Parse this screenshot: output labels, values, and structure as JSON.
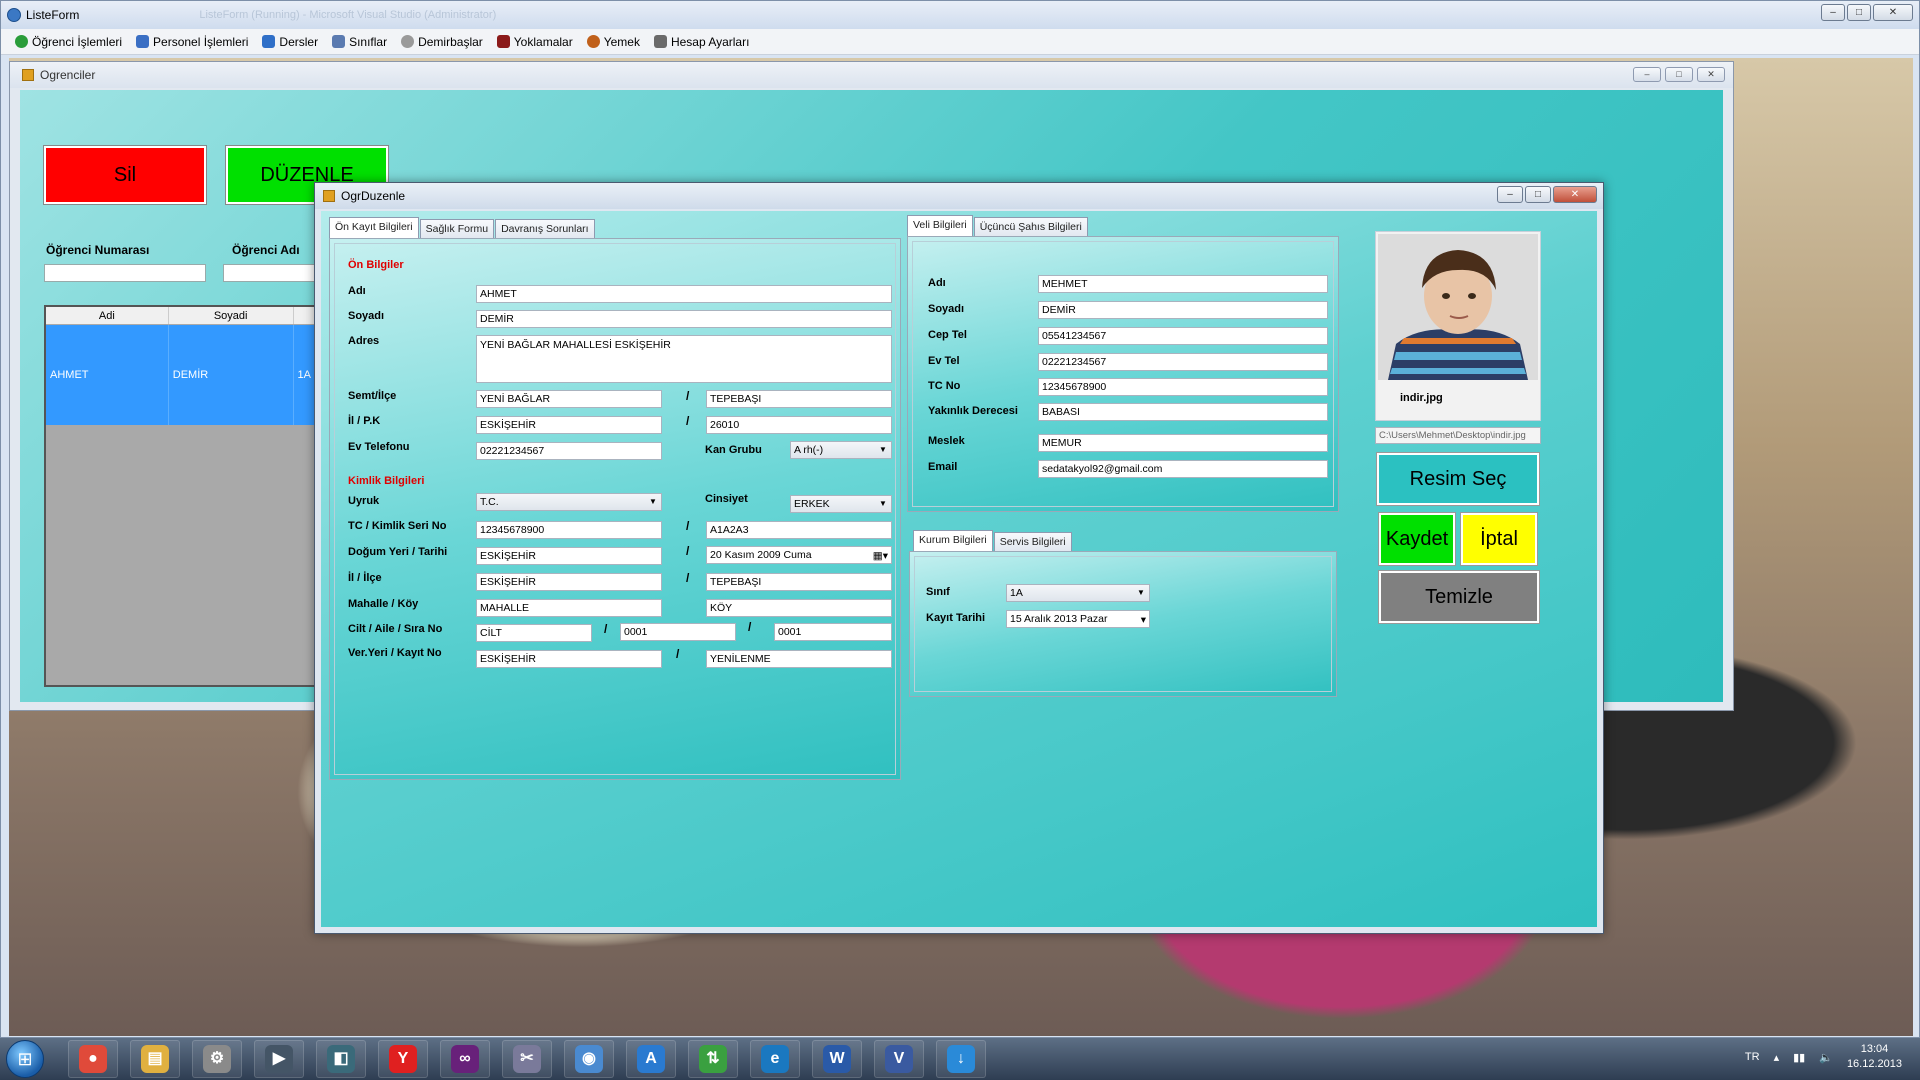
{
  "main_window": {
    "title": "ListeForm",
    "ghost_title": "ListeForm (Running) - Microsoft Visual Studio (Administrator)",
    "controls": [
      "–",
      "□",
      "✕"
    ]
  },
  "menu": {
    "items": [
      {
        "label": "Öğrenci İşlemleri",
        "icon": "student-icon",
        "color": "#2a9d3a"
      },
      {
        "label": "Personel İşlemleri",
        "icon": "staff-icon",
        "color": "#3a6fc4"
      },
      {
        "label": "Dersler",
        "icon": "lessons-icon",
        "color": "#2f6fc8"
      },
      {
        "label": "Sınıflar",
        "icon": "classes-icon",
        "color": "#5a7ab0"
      },
      {
        "label": "Demirbaşlar",
        "icon": "inventory-icon",
        "color": "#9a9a9a"
      },
      {
        "label": "Yoklamalar",
        "icon": "attendance-icon",
        "color": "#8b1a1a"
      },
      {
        "label": "Yemek",
        "icon": "food-icon",
        "color": "#c0601a"
      },
      {
        "label": "Hesap Ayarları",
        "icon": "account-icon",
        "color": "#6a6a6a"
      }
    ]
  },
  "ogrenciler": {
    "title": "Ogrenciler",
    "sil_label": "Sil",
    "duzenle_label": "DÜZENLE",
    "ogrenci_no_label": "Öğrenci Numarası",
    "ogrenci_adi_label": "Öğrenci Adı",
    "grid": {
      "columns": [
        "Adi",
        "Soyadi",
        ""
      ],
      "rows": [
        [
          "AHMET",
          "DEMİR",
          "1A"
        ]
      ]
    }
  },
  "dialog": {
    "title": "OgrDuzenle",
    "left_tabs": [
      "Ön Kayıt Bilgileri",
      "Sağlık Formu",
      "Davranış Sorunları"
    ],
    "on_bilgiler": "Ön Bilgiler",
    "adi_label": "Adı",
    "adi": "AHMET",
    "soyadi_label": "Soyadı",
    "soyadi": "DEMİR",
    "adres_label": "Adres",
    "adres": "YENİ BAĞLAR MAHALLESİ ESKİŞEHİR",
    "semt_label": "Semt/İlçe",
    "semt": "YENİ BAĞLAR",
    "ilce": "TEPEBAŞI",
    "il_pk_label": "İl / P.K",
    "il": "ESKİŞEHİR",
    "pk": "26010",
    "ev_tel_label": "Ev Telefonu",
    "ev_tel": "02221234567",
    "kan_grubu_label": "Kan Grubu",
    "kan_grubu": "A rh(-)",
    "kimlik_bilgileri": "Kimlik Bilgileri",
    "uyruk_label": "Uyruk",
    "uyruk": "T.C.",
    "cinsiyet_label": "Cinsiyet",
    "cinsiyet": "ERKEK",
    "tc_label": "TC / Kimlik Seri No",
    "tc": "12345678900",
    "seri": "A1A2A3",
    "dogum_label": "Doğum Yeri / Tarihi",
    "dogum_yeri": "ESKİŞEHİR",
    "dogum_tarihi": "20   Kasım   2009     Cuma",
    "il_ilce_label": "İl / İlçe",
    "k_il": "ESKİŞEHİR",
    "k_ilce": "TEPEBAŞI",
    "mahalle_label": "Mahalle / Köy",
    "mahalle": "MAHALLE",
    "koy": "KÖY",
    "cilt_label": "Cilt / Aile / Sıra No",
    "cilt": "CİLT",
    "aile": "0001",
    "sira": "0001",
    "ver_label": "Ver.Yeri / Kayıt No",
    "ver_yeri": "ESKİŞEHİR",
    "kayit_no": "YENİLENME",
    "slash": "/",
    "veli_tabs": [
      "Veli Bilgileri",
      "Üçüncü Şahıs Bilgileri"
    ],
    "veli": {
      "adi_label": "Adı",
      "adi": "MEHMET",
      "soyadi_label": "Soyadı",
      "soyadi": "DEMİR",
      "cep_label": "Cep Tel",
      "cep": "05541234567",
      "ev_label": "Ev Tel",
      "ev": "02221234567",
      "tc_label": "TC No",
      "tc": "12345678900",
      "yakinlik_label": "Yakınlık Derecesi",
      "yakinlik": "BABASI",
      "meslek_label": "Meslek",
      "meslek": "MEMUR",
      "email_label": "Email",
      "email": "sedatakyol92@gmail.com"
    },
    "kurum_tabs": [
      "Kurum Bilgileri",
      "Servis Bilgileri"
    ],
    "kurum": {
      "sinif_label": "Sınıf",
      "sinif": "1A",
      "kayit_label": "Kayıt Tarihi",
      "kayit": "15    Aralık    2013      Pazar"
    },
    "photo_caption": "indir.jpg",
    "photo_path": "C:\\Users\\Mehmet\\Desktop\\indir.jpg",
    "resim_sec": "Resim Seç",
    "kaydet": "Kaydet",
    "iptal": "İptal",
    "temizle": "Temizle"
  },
  "taskbar": {
    "apps": [
      {
        "name": "chrome-icon",
        "glyph": "●",
        "color": "#e04a3a"
      },
      {
        "name": "explorer-icon",
        "glyph": "▤",
        "color": "#e0b040"
      },
      {
        "name": "tools-icon",
        "glyph": "⚙",
        "color": "#8a8a8a"
      },
      {
        "name": "media-icon",
        "glyph": "▶",
        "color": "#445566"
      },
      {
        "name": "control-icon",
        "glyph": "◧",
        "color": "#3a6a7a"
      },
      {
        "name": "yandex-icon",
        "glyph": "Y",
        "color": "#e02020"
      },
      {
        "name": "visual-studio-icon",
        "glyph": "∞",
        "color": "#68217a"
      },
      {
        "name": "utility-icon",
        "glyph": "✂",
        "color": "#7a7a9a"
      },
      {
        "name": "sphere-icon",
        "glyph": "◉",
        "color": "#4a8ad0"
      },
      {
        "name": "app-store-icon",
        "glyph": "A",
        "color": "#2a7ad0"
      },
      {
        "name": "transfer-icon",
        "glyph": "⇅",
        "color": "#3aa040"
      },
      {
        "name": "edge-icon",
        "glyph": "e",
        "color": "#1a78c0"
      },
      {
        "name": "word-icon",
        "glyph": "W",
        "color": "#2a5aa8"
      },
      {
        "name": "visio-icon",
        "glyph": "V",
        "color": "#3a5aa0"
      },
      {
        "name": "download-icon",
        "glyph": "↓",
        "color": "#2a8ad8"
      }
    ],
    "lang": "TR",
    "time": "13:04",
    "date": "16.12.2013"
  }
}
